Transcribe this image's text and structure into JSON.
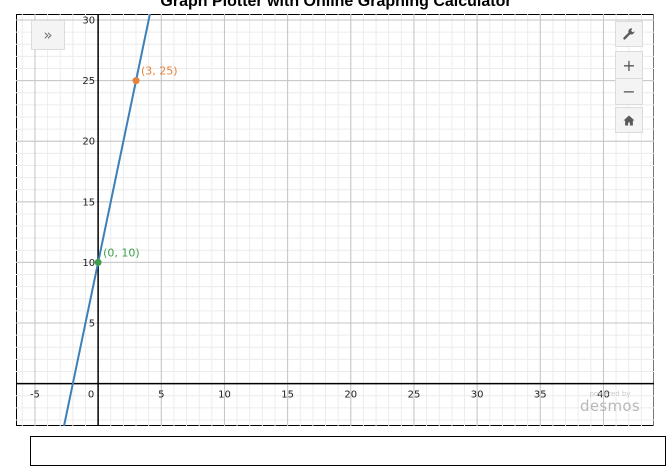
{
  "title": "Graph Plotter with Online Graphing Calculator",
  "toolbar": {
    "expand_icon": "double-chevron-right-icon",
    "expand_glyph": "»",
    "wrench_icon": "wrench-icon",
    "wrench_glyph": "🔧",
    "zoom_in_icon": "plus-icon",
    "zoom_in_glyph": "+",
    "zoom_out_icon": "minus-icon",
    "zoom_out_glyph": "−",
    "home_icon": "home-icon",
    "home_glyph": "⌂"
  },
  "branding": {
    "powered_by": "powered by",
    "name": "desmos"
  },
  "answer_input": {
    "value": ""
  },
  "chart_data": {
    "type": "line",
    "xlim": [
      -6.5,
      44
    ],
    "ylim": [
      -3.5,
      30.5
    ],
    "x_ticks": [
      -5,
      0,
      5,
      10,
      15,
      20,
      25,
      30,
      35,
      40
    ],
    "x_tick_labels": [
      "-5",
      "0",
      "5",
      "10",
      "15",
      "20",
      "25",
      "30",
      "35",
      "40"
    ],
    "y_ticks": [
      5,
      10,
      15,
      20,
      25,
      30
    ],
    "y_tick_labels": [
      "5",
      "10",
      "15",
      "20",
      "25",
      "30"
    ],
    "grid": true,
    "minor_grid_step": 1,
    "series": [
      {
        "color": "#3d7fb8",
        "slope": 5,
        "intercept": 10
      }
    ],
    "points": [
      {
        "x": 0,
        "y": 10,
        "label": "(0, 10)",
        "color": "#3f9e4d"
      },
      {
        "x": 3,
        "y": 25,
        "label": "(3, 25)",
        "color": "#e6823a"
      }
    ]
  }
}
